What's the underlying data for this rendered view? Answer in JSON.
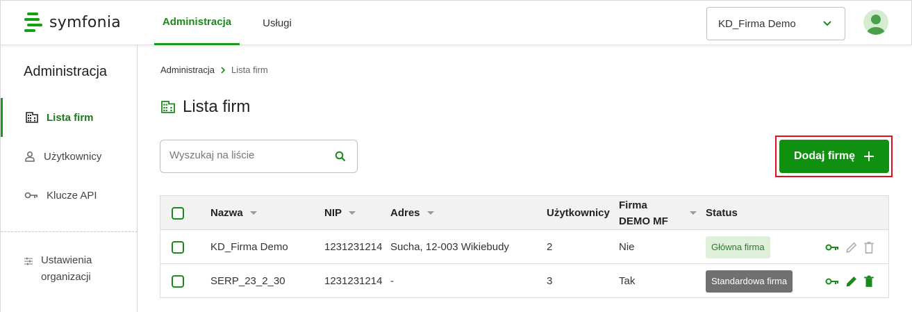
{
  "brand": {
    "name": "symfonia",
    "accent": "#109010",
    "highlight": "#e0101a"
  },
  "topnav": {
    "tabs": [
      {
        "label": "Administracja",
        "active": true
      },
      {
        "label": "Usługi",
        "active": false
      }
    ]
  },
  "company_selector": {
    "value": "KD_Firma Demo",
    "icon": "chevron-down-icon"
  },
  "user": {
    "avatar_icon": "person-avatar-icon"
  },
  "sidebar": {
    "title": "Administracja",
    "items": [
      {
        "label": "Lista firm",
        "icon": "building-icon",
        "active": true
      },
      {
        "label": "Użytkownicy",
        "icon": "user-icon",
        "active": false
      },
      {
        "label": "Klucze API",
        "icon": "key-icon",
        "active": false
      }
    ],
    "settings": {
      "line1": "Ustawienia",
      "line2": "organizacji",
      "icon": "sliders-icon"
    }
  },
  "breadcrumb": {
    "parent": "Administracja",
    "current": "Lista firm"
  },
  "page": {
    "title": "Lista firm",
    "icon": "building-icon"
  },
  "search": {
    "placeholder": "Wyszukaj na liście",
    "value": ""
  },
  "add_button": {
    "label": "Dodaj firmę",
    "icon": "plus-icon"
  },
  "table": {
    "headers": {
      "name": "Nazwa",
      "nip": "NIP",
      "address": "Adres",
      "users": "Użytkownicy",
      "demo_line1": "Firma",
      "demo_line2": "DEMO MF",
      "status": "Status"
    },
    "rows": [
      {
        "name": "KD_Firma Demo",
        "nip": "1231231214",
        "address": "Sucha, 12-003 Wikiebudy",
        "users": "2",
        "demo": "Nie",
        "status": "Główna firma",
        "status_kind": "main",
        "actions_enabled": false
      },
      {
        "name": "SERP_23_2_30",
        "nip": "1231231214",
        "address": "-",
        "users": "3",
        "demo": "Tak",
        "status": "Standardowa firma",
        "status_kind": "standard",
        "actions_enabled": true
      }
    ]
  }
}
